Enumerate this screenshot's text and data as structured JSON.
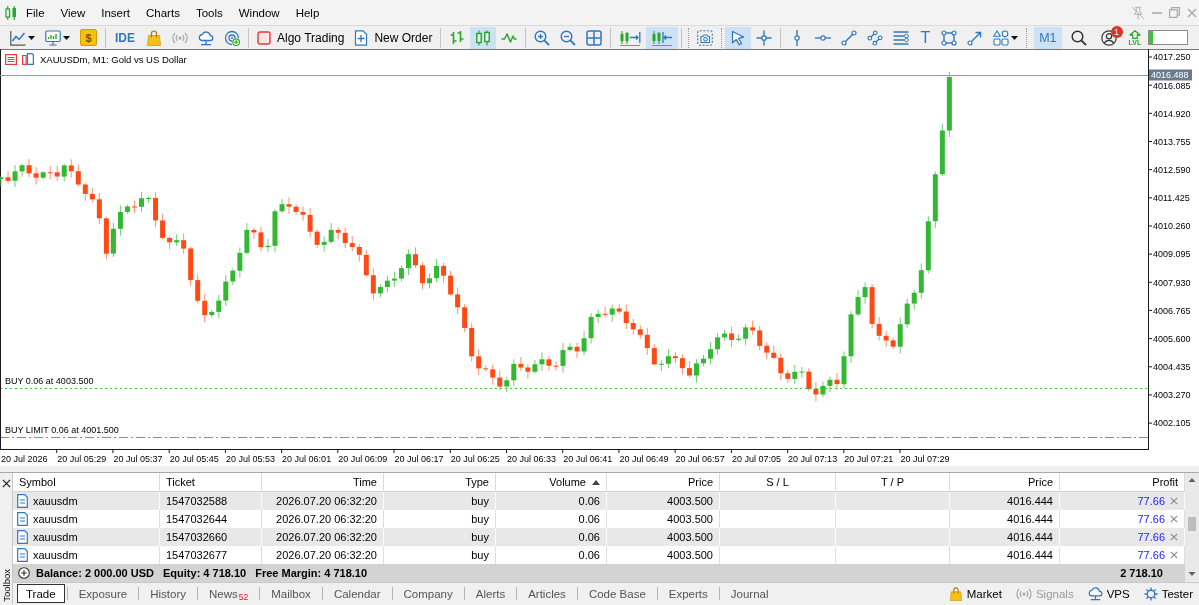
{
  "menu_bar": {
    "items": [
      "File",
      "View",
      "Insert",
      "Charts",
      "Tools",
      "Window",
      "Help"
    ]
  },
  "toolbar": {
    "deposit": {
      "label": "$"
    },
    "ide": {
      "label": "IDE"
    },
    "signals": {
      "disabled": true
    },
    "algo_trading": {
      "label": "Algo Trading",
      "on": false
    },
    "new_order": {
      "label": "New Order"
    },
    "chart_types": [
      {
        "selected": false
      },
      {
        "selected": true
      },
      {
        "selected": false
      }
    ],
    "chart_shift": {
      "on": false
    },
    "auto_scroll": {
      "on": true
    },
    "pointer_tools": [
      {
        "selected": true
      },
      {
        "selected": false
      }
    ],
    "text_tool": {
      "label": "T"
    },
    "timeframe": {
      "label": "M1",
      "selected": true
    },
    "account": {
      "badge": "1"
    },
    "level_indicator": {
      "label": "LVL"
    },
    "meter": {
      "level": 0.1
    }
  },
  "chart": {
    "title": "XAUUSDm, M1: Gold vs US Dollar",
    "current_price": "4016.488",
    "price_ticks": [
      "4017.250",
      "4016.085",
      "4014.920",
      "4013.755",
      "4012.590",
      "4011.425",
      "4010.260",
      "4009.095",
      "4007.930",
      "4006.765",
      "4005.600",
      "4004.435",
      "4003.270",
      "4002.105"
    ],
    "time_labels": [
      "20 Jul 2026",
      "20 Jul 05:29",
      "20 Jul 05:37",
      "20 Jul 05:45",
      "20 Jul 05:53",
      "20 Jul 06:01",
      "20 Jul 06:09",
      "20 Jul 06:17",
      "20 Jul 06:25",
      "20 Jul 06:33",
      "20 Jul 06:41",
      "20 Jul 06:49",
      "20 Jul 06:57",
      "20 Jul 07:05",
      "20 Jul 07:13",
      "20 Jul 07:21",
      "20 Jul 07:29"
    ],
    "order_lines": [
      {
        "kind": "position",
        "label": "BUY 0.06 at 4003.500"
      },
      {
        "kind": "limit",
        "label": "BUY LIMIT 0.06 at 4001.500"
      }
    ]
  },
  "toolbox": {
    "title": "Toolbox",
    "table": {
      "columns": [
        {
          "label": "Symbol",
          "sorted": false
        },
        {
          "label": "Ticket",
          "sorted": false
        },
        {
          "label": "Time",
          "sorted": false
        },
        {
          "label": "Type",
          "sorted": false
        },
        {
          "label": "Volume",
          "sorted": true
        },
        {
          "label": "Price",
          "sorted": false
        },
        {
          "label": "S / L",
          "sorted": false
        },
        {
          "label": "T / P",
          "sorted": false
        },
        {
          "label": "Price",
          "sorted": false
        },
        {
          "label": "Profit",
          "sorted": false
        }
      ],
      "rows": [
        {
          "symbol": "xauusdm",
          "ticket": "1547032588",
          "time": "2026.07.20 06:32:20",
          "type": "buy",
          "volume": "0.06",
          "open_price": "4003.500",
          "current_price": "4016.444",
          "profit": "77.66"
        },
        {
          "symbol": "xauusdm",
          "ticket": "1547032644",
          "time": "2026.07.20 06:32:20",
          "type": "buy",
          "volume": "0.06",
          "open_price": "4003.500",
          "current_price": "4016.444",
          "profit": "77.66"
        },
        {
          "symbol": "xauusdm",
          "ticket": "1547032660",
          "time": "2026.07.20 06:32:20",
          "type": "buy",
          "volume": "0.06",
          "open_price": "4003.500",
          "current_price": "4016.444",
          "profit": "77.66"
        },
        {
          "symbol": "xauusdm",
          "ticket": "1547032677",
          "time": "2026.07.20 06:32:20",
          "type": "buy",
          "volume": "0.06",
          "open_price": "4003.500",
          "current_price": "4016.444",
          "profit": "77.66"
        }
      ],
      "summary": {
        "balance": "Balance: 2 000.00 USD",
        "equity": "Equity: 4 718.10",
        "free_margin": "Free Margin: 4 718.10",
        "profit": "2 718.10"
      }
    },
    "tabs": [
      {
        "label": "Trade",
        "selected": true
      },
      {
        "label": "Exposure",
        "selected": false
      },
      {
        "label": "History",
        "selected": false
      },
      {
        "label": "News",
        "badge": "52",
        "selected": false
      },
      {
        "label": "Mailbox",
        "selected": false
      },
      {
        "label": "Calendar",
        "selected": false
      },
      {
        "label": "Company",
        "selected": false
      },
      {
        "label": "Alerts",
        "selected": false
      },
      {
        "label": "Articles",
        "selected": false
      },
      {
        "label": "Code Base",
        "selected": false
      },
      {
        "label": "Experts",
        "selected": false
      },
      {
        "label": "Journal",
        "selected": false
      }
    ],
    "services": [
      {
        "label": "Market",
        "disabled": false
      },
      {
        "label": "Signals",
        "disabled": true
      },
      {
        "label": "VPS",
        "disabled": false
      },
      {
        "label": "Tester",
        "disabled": false
      }
    ]
  }
}
